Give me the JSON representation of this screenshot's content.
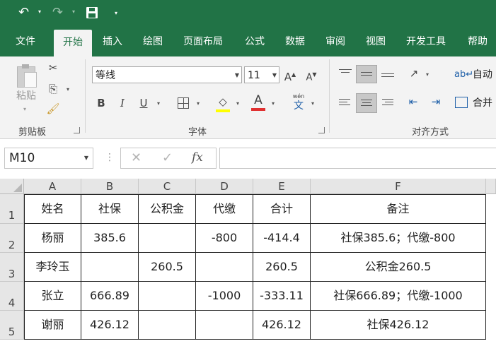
{
  "quick_access": {
    "undo_icon": "undo-icon",
    "redo_icon": "redo-icon",
    "save_icon": "save-icon",
    "customize_icon": "customize-icon"
  },
  "tabs": [
    "文件",
    "开始",
    "插入",
    "绘图",
    "页面布局",
    "公式",
    "数据",
    "审阅",
    "视图",
    "开发工具",
    "帮助"
  ],
  "active_tab": "开始",
  "ribbon": {
    "clipboard": {
      "label": "剪贴板",
      "paste_label": "粘贴"
    },
    "font": {
      "label": "字体",
      "font_name": "等线",
      "font_size": "11",
      "bold": "B",
      "italic": "I",
      "underline": "U",
      "phonetic": "wén"
    },
    "alignment": {
      "label": "对齐方式",
      "wrap_text": "自动",
      "merge": "合并"
    }
  },
  "formula_bar": {
    "name_box": "M10",
    "fx": "fx",
    "cancel": "✕",
    "enter": "✓",
    "formula": ""
  },
  "columns": [
    "A",
    "B",
    "C",
    "D",
    "E",
    "F"
  ],
  "rows": [
    "1",
    "2",
    "3",
    "4",
    "5"
  ],
  "cells": [
    [
      "姓名",
      "社保",
      "公积金",
      "代缴",
      "合计",
      "备注"
    ],
    [
      "杨丽",
      "385.6",
      "",
      "-800",
      "-414.4",
      "社保385.6；代缴-800"
    ],
    [
      "李玲玉",
      "",
      "260.5",
      "",
      "260.5",
      "公积金260.5"
    ],
    [
      "张立",
      "666.89",
      "",
      "-1000",
      "-333.11",
      "社保666.89；代缴-1000"
    ],
    [
      "谢丽",
      "426.12",
      "",
      "",
      "426.12",
      "社保426.12"
    ]
  ],
  "colors": {
    "accent": "#217346",
    "ribbon_bg": "#f3f3f3",
    "header_bg": "#e6e6e6",
    "font_color_red": "#e03030"
  }
}
